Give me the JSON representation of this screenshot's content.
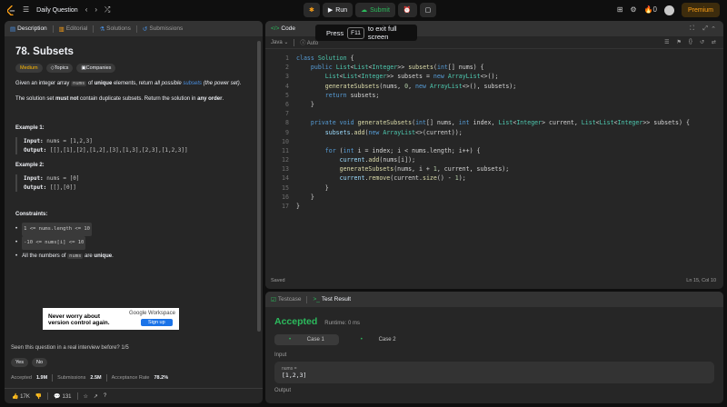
{
  "topbar": {
    "title": "Daily Question",
    "run": "Run",
    "submit": "Submit",
    "premium": "Premium",
    "count": "0"
  },
  "left": {
    "tabs": [
      "Description",
      "Editorial",
      "Solutions",
      "Submissions"
    ],
    "title": "78. Subsets",
    "tags": [
      "Medium",
      "Topics",
      "Companies"
    ],
    "desc1_a": "Given an integer array ",
    "desc1_code": "nums",
    "desc1_b": " of ",
    "desc1_bold": "unique",
    "desc1_c": " elements, return ",
    "desc1_it": "all possible",
    "desc1_link": " subsets",
    "desc1_d": " (the power set).",
    "desc2_a": "The solution set ",
    "desc2_bold": "must not",
    "desc2_b": " contain duplicate subsets. Return the solution in ",
    "desc2_bold2": "any order",
    "desc2_c": ".",
    "ex1_h": "Example 1:",
    "ex1_in_l": "Input:",
    "ex1_in": " nums = [1,2,3]",
    "ex1_out_l": "Output:",
    "ex1_out": " [[],[1],[2],[1,2],[3],[1,3],[2,3],[1,2,3]]",
    "ex2_h": "Example 2:",
    "ex2_in_l": "Input:",
    "ex2_in": " nums = [0]",
    "ex2_out_l": "Output:",
    "ex2_out": " [[],[0]]",
    "cons_h": "Constraints:",
    "cons1": "1 <= nums.length <= 10",
    "cons2": "-10 <= nums[i] <= 10",
    "cons3_a": "All the numbers of ",
    "cons3_code": "nums",
    "cons3_b": " are ",
    "cons3_bold": "unique",
    "cons3_c": ".",
    "ad_l1": "Never worry about",
    "ad_l2": "version control again.",
    "ad_g": "Google Workspace",
    "ad_su": "Sign up",
    "seen": "Seen this question in a real interview before?   1/5",
    "yes": "Yes",
    "no": "No",
    "accepted_l": "Accepted",
    "accepted_v": "1.9M",
    "subs_l": "Submissions",
    "subs_v": "2.5M",
    "rate_l": "Acceptance Rate",
    "rate_v": "78.2%",
    "likes": "17K",
    "comments": "131"
  },
  "editor": {
    "tab": "Code",
    "lang": "Java",
    "auto": "Auto",
    "toast_a": "Press",
    "toast_key": "F11",
    "toast_b": "to exit full screen",
    "saved": "Saved",
    "pos": "Ln 15, Col 10"
  },
  "result": {
    "tab1": "Testcase",
    "tab2": "Test Result",
    "status": "Accepted",
    "runtime": "Runtime: 0 ms",
    "case1": "Case 1",
    "case2": "Case 2",
    "input_l": "Input",
    "var": "nums =",
    "val": "[1,2,3]",
    "output_l": "Output"
  },
  "colors": {
    "accent": "#ffa116",
    "green": "#2cbb5d",
    "panel": "#262626"
  }
}
